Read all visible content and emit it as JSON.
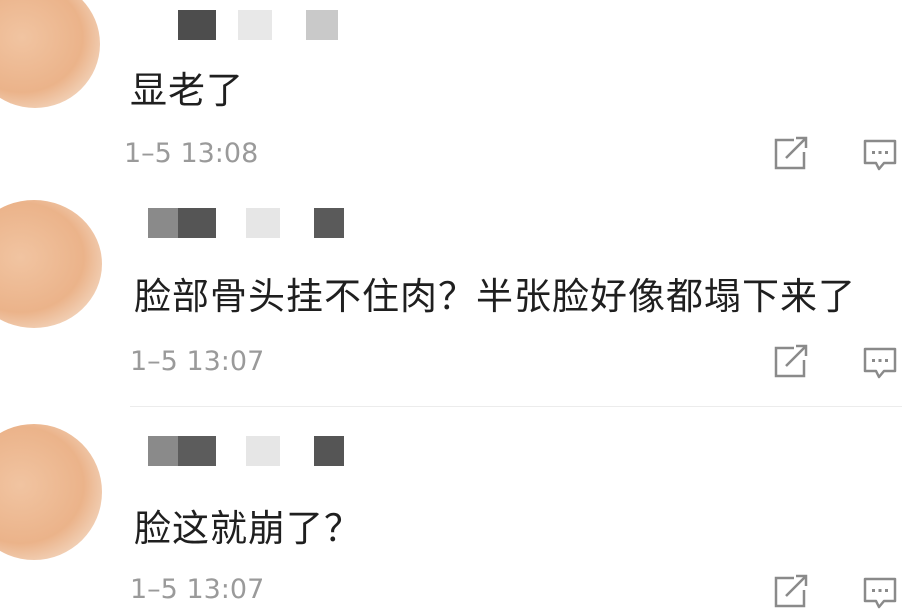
{
  "comments": [
    {
      "text": "显老了",
      "time": "1–5 13:08",
      "share_icon": "share-icon",
      "reply_icon": "comment-icon"
    },
    {
      "text": "脸部骨头挂不住肉？半张脸好像都塌下来了",
      "time": "1–5 13:07",
      "share_icon": "share-icon",
      "reply_icon": "comment-icon"
    },
    {
      "text": "脸这就崩了？",
      "time": "1–5 13:07",
      "share_icon": "share-icon",
      "reply_icon": "comment-icon"
    }
  ],
  "colors": {
    "text": "#1f1f1f",
    "timestamp": "#9a9a9a",
    "icon": "#8a8a8a",
    "avatar": "#ebb38a",
    "blur_dark": "#555555",
    "blur_light": "#e6e6e6"
  }
}
